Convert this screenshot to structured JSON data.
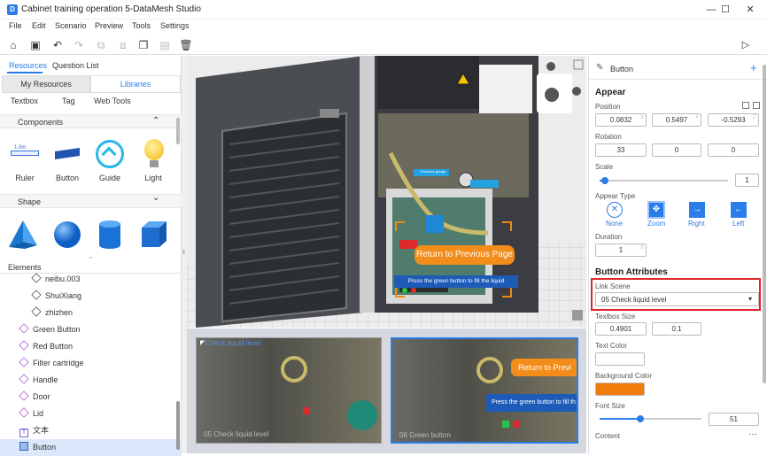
{
  "app": {
    "title": "Cabinet training operation 5-DataMesh Studio",
    "logo_text": "D"
  },
  "window": {
    "minimize": "—",
    "maximize": "☐",
    "close": "✕"
  },
  "menu": [
    "File",
    "Edit",
    "Scenario",
    "Preview",
    "Tools",
    "Settings"
  ],
  "left": {
    "tabs": [
      "Resources",
      "Question List"
    ],
    "subtabs": [
      "My Resources",
      "Libraries"
    ],
    "lib_tabs": [
      "Textbox",
      "Tag",
      "Web Tools"
    ],
    "components_title": "Components",
    "components": [
      "Ruler",
      "Button",
      "Guide",
      "Light"
    ],
    "ruler_text": "1.0m",
    "shape_title": "Shape",
    "elements_title": "Elements",
    "elements": [
      "neibu.003",
      "ShuiXiang",
      "zhizhen",
      "Green Button",
      "Red Button",
      "Filter cartridge",
      "Handle",
      "Door",
      "Lid",
      "文本",
      "Button"
    ]
  },
  "viewport": {
    "overlay_button": "Return to Previous Page",
    "overlay_text": "Press the green button to fill the liquid",
    "small_label": "Pressure gauge"
  },
  "thumbs": [
    {
      "caption": "Check liquid level",
      "footer": "05   Check liquid level"
    },
    {
      "caption": "Return to Previ",
      "overlay": "Press the green button to fill th",
      "footer": "06   Green button"
    }
  ],
  "right": {
    "component_name": "Button",
    "appear": "Appear",
    "position_label": "Position",
    "position": [
      "0.0832",
      "0.5497",
      "-0.5293"
    ],
    "rotation_label": "Rotation",
    "rotation": [
      "33",
      "0",
      "0"
    ],
    "axes": [
      "X",
      "Y",
      "Z"
    ],
    "scale_label": "Scale",
    "scale": "1",
    "scale_fraction": 0.04,
    "appear_type_label": "Appear Type",
    "appear_types": [
      "None",
      "Zoom",
      "Right",
      "Left"
    ],
    "duration_label": "Duration",
    "duration": "1",
    "duration_unit": "S",
    "attrs_title": "Button Attributes",
    "link_scene_label": "Link Scene",
    "link_scene_value": "05  Check liquid level",
    "textbox_size_label": "Textbox Size",
    "textbox_size": [
      "0.4901",
      "0.1"
    ],
    "text_color_label": "Text Color",
    "bg_color_label": "Background Color",
    "bg_color": "#f07c0a",
    "font_size_label": "Font Size",
    "font_size": "51",
    "font_size_fraction": 0.4,
    "content_label": "Content",
    "more": "···",
    "highlight_color": "#e0242a"
  }
}
